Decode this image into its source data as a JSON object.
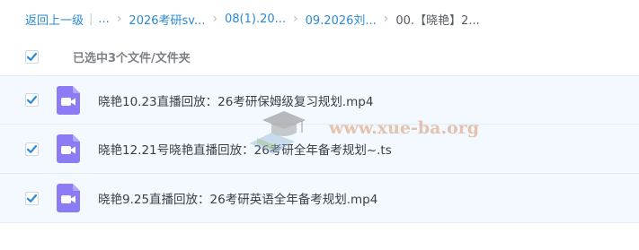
{
  "breadcrumb": {
    "back_label": "返回上一级",
    "separator": "|",
    "ellipsis": "...",
    "arrow": "›",
    "crumbs": [
      "2026考研sv...",
      "08(1).20...",
      "09.2026刘..."
    ],
    "current": "00.【晓艳】2..."
  },
  "selection": {
    "label": "已选中3个文件/文件夹",
    "all_checked": true
  },
  "files": [
    {
      "name": "晓艳10.23直播回放：26考研保姆级复习规划.mp4",
      "checked": true,
      "icon": "video-file-icon"
    },
    {
      "name": "晓艳12.21号晓艳直播回放：26考研全年备考规划~.ts",
      "checked": true,
      "icon": "video-file-icon"
    },
    {
      "name": "晓艳9.25直播回放：26考研英语全年备考规划.mp4",
      "checked": true,
      "icon": "video-file-icon"
    }
  ],
  "watermark": {
    "text": "www.xue-ba.org"
  },
  "colors": {
    "accent": "#2a8ad6",
    "row_selected_bg": "#f3f9fe",
    "video_icon": "#8b7cf6"
  }
}
